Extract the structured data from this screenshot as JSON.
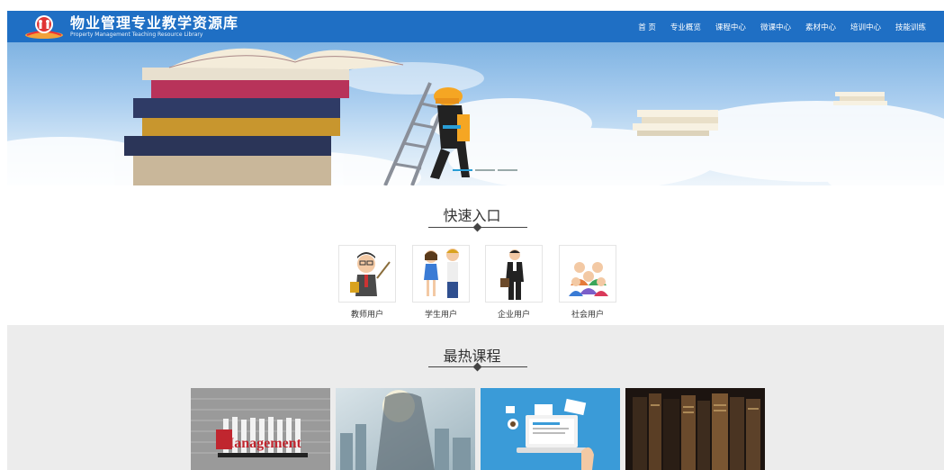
{
  "header": {
    "title": "物业管理专业教学资源库",
    "subtitle": "Property Management Teaching Resource Library",
    "nav": [
      "首 页",
      "专业概览",
      "课程中心",
      "微课中心",
      "素材中心",
      "培训中心",
      "技能训练"
    ]
  },
  "banner": {
    "slide_count": 3,
    "active_slide": 1
  },
  "quick_entry": {
    "title": "快速入口",
    "items": [
      {
        "label": "教师用户",
        "icon": "teacher-icon"
      },
      {
        "label": "学生用户",
        "icon": "students-icon"
      },
      {
        "label": "企业用户",
        "icon": "businessman-icon"
      },
      {
        "label": "社会用户",
        "icon": "community-icon"
      }
    ]
  },
  "hot_courses": {
    "title": "最热课程",
    "items": [
      {
        "thumb": "management-books-thumb",
        "caption_art": "Management"
      },
      {
        "thumb": "city-businessman-thumb"
      },
      {
        "thumb": "laptop-office-thumb"
      },
      {
        "thumb": "bookshelf-thumb"
      }
    ]
  },
  "colors": {
    "header": "#1f6fc4",
    "accent": "#2a9ed6",
    "section_bg": "#ececec"
  }
}
